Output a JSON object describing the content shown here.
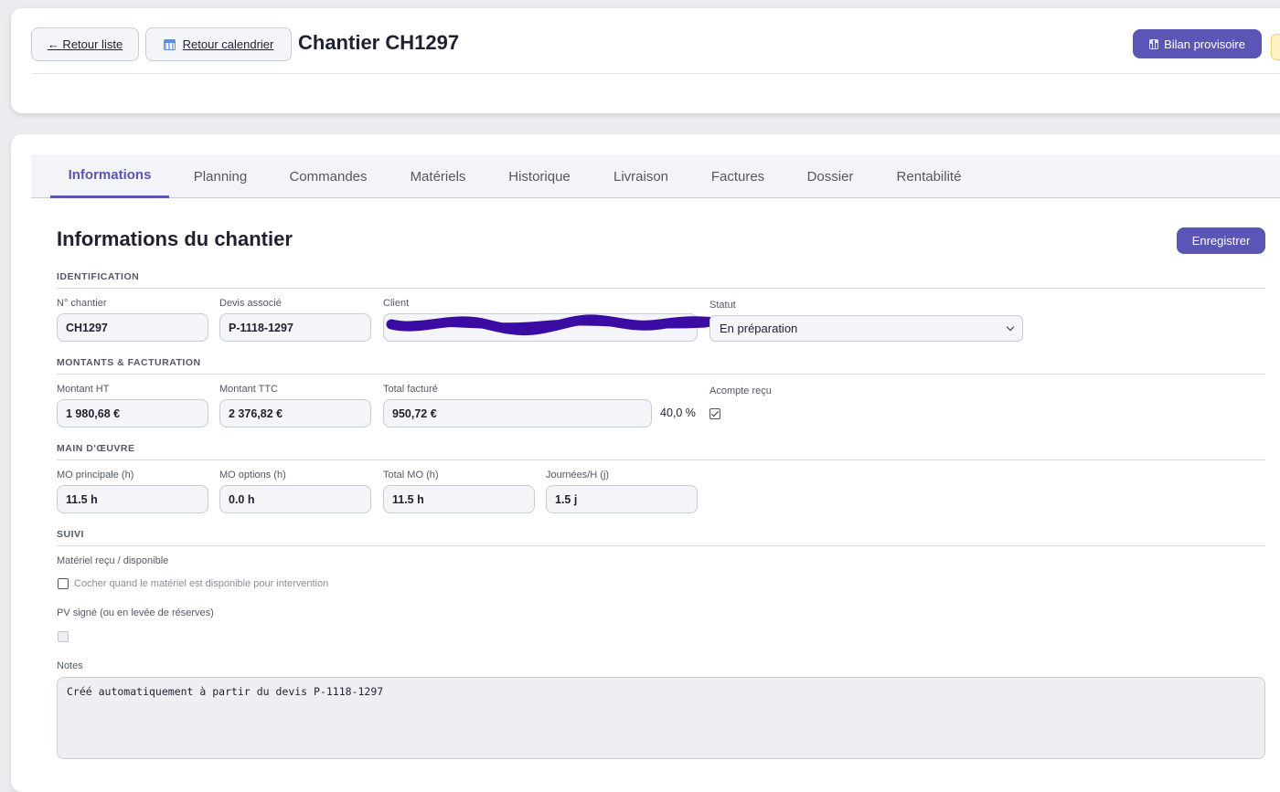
{
  "header": {
    "back_list_label": "← Retour liste",
    "back_calendar_label": "Retour calendrier",
    "title": "Chantier CH1297",
    "bilan_label": "Bilan provisoire"
  },
  "tabs": [
    {
      "label": "Informations",
      "active": true
    },
    {
      "label": "Planning"
    },
    {
      "label": "Commandes"
    },
    {
      "label": "Matériels"
    },
    {
      "label": "Historique"
    },
    {
      "label": "Livraison"
    },
    {
      "label": "Factures"
    },
    {
      "label": "Dossier"
    },
    {
      "label": "Rentabilité"
    }
  ],
  "form": {
    "title": "Informations du chantier",
    "save_label": "Enregistrer",
    "identification": {
      "heading": "IDENTIFICATION",
      "chantier_label": "N° chantier",
      "chantier_value": "CH1297",
      "devis_label": "Devis associé",
      "devis_value": "P-1118-1297",
      "client_label": "Client",
      "client_value": "",
      "statut_label": "Statut",
      "statut_value": "En préparation"
    },
    "montants": {
      "heading": "MONTANTS & FACTURATION",
      "ht_label": "Montant HT",
      "ht_value": "1 980,68 €",
      "ttc_label": "Montant TTC",
      "ttc_value": "2 376,82 €",
      "facture_label": "Total facturé",
      "facture_value": "950,72 €",
      "facture_pct": "40,0 %",
      "acompte_label": "Acompte reçu",
      "acompte_checked": true
    },
    "main_oeuvre": {
      "heading": "MAIN D'ŒUVRE",
      "mo_principale_label": "MO principale (h)",
      "mo_principale_value": "11.5 h",
      "mo_options_label": "MO options (h)",
      "mo_options_value": "0.0 h",
      "total_mo_label": "Total MO (h)",
      "total_mo_value": "11.5 h",
      "journees_label": "Journées/H (j)",
      "journees_value": "1.5 j"
    },
    "suivi": {
      "heading": "SUIVI",
      "materiel_label": "Matériel reçu / disponible",
      "materiel_hint": "Cocher quand le matériel est disponible pour intervention",
      "pv_label": "PV signé (ou en levée de réserves)",
      "notes_label": "Notes",
      "notes_value": "Créé automatiquement à partir du devis P-1118-1297"
    }
  },
  "colors": {
    "accent": "#5b55b5",
    "redaction": "#3a0ca3"
  }
}
